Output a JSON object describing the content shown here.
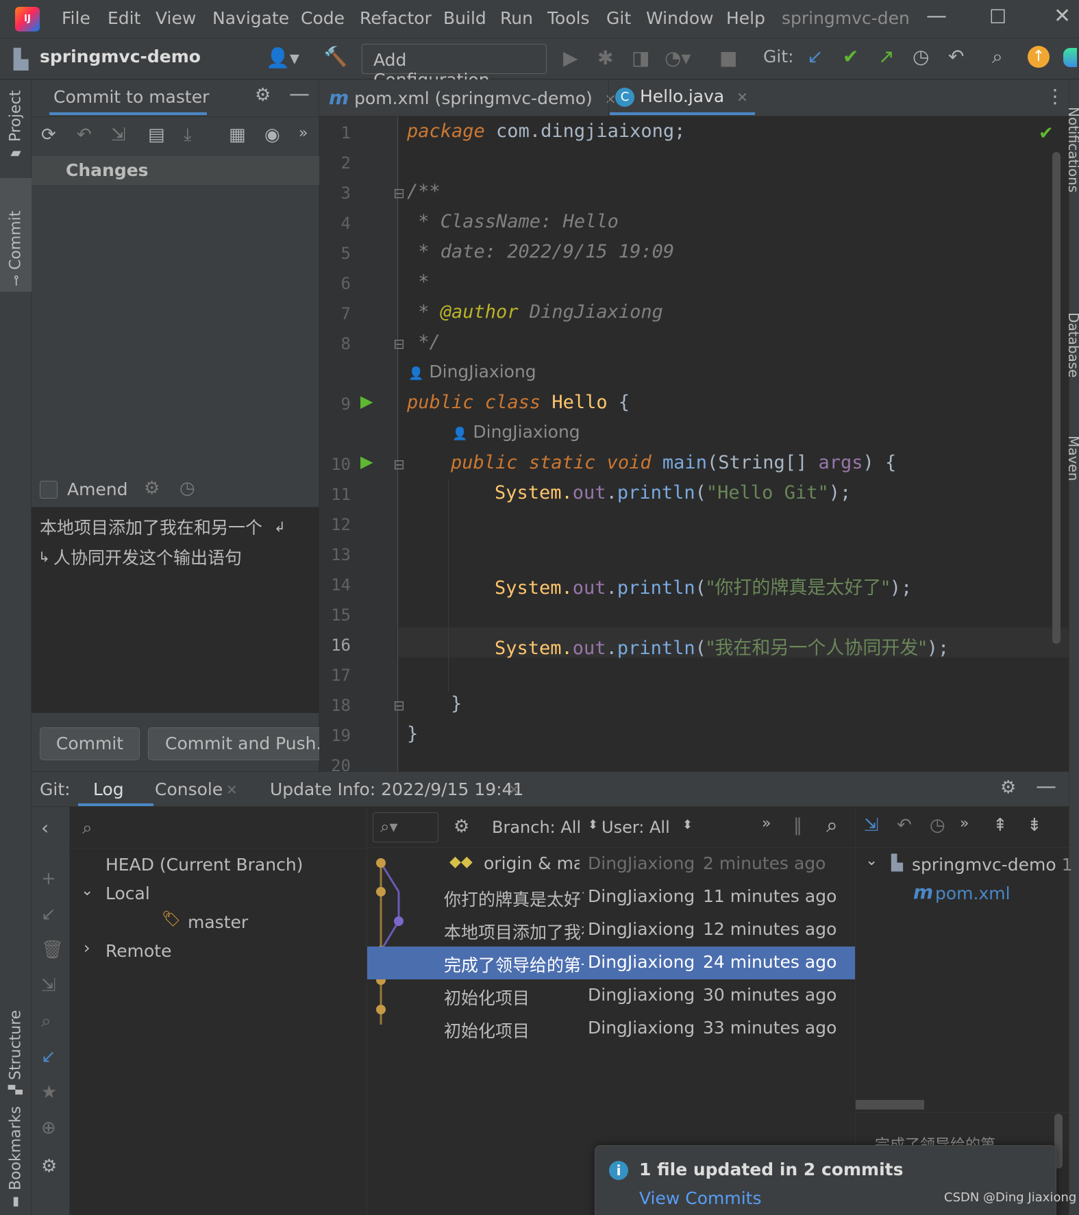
{
  "menu": {
    "items": [
      "File",
      "Edit",
      "View",
      "Navigate",
      "Code",
      "Refactor",
      "Build",
      "Run",
      "Tools",
      "Git",
      "Window",
      "Help"
    ],
    "project_title": "springmvc-den"
  },
  "toolbar": {
    "project_name": "springmvc-demo",
    "add_configuration": "Add Configuration...",
    "git_label": "Git:"
  },
  "left_tabs": {
    "project": "Project",
    "commit": "Commit",
    "structure": "Structure",
    "bookmarks": "Bookmarks"
  },
  "right_tabs": {
    "notifications": "Notifications",
    "database": "Database",
    "maven": "Maven"
  },
  "commit_panel": {
    "tab_label": "Commit to master",
    "changes_header": "Changes",
    "amend_label": "Amend",
    "message_line1": "本地项目添加了我在和另一个",
    "message_line2": "人协同开发这个输出语句",
    "commit_button": "Commit",
    "commit_push_button": "Commit and Push..."
  },
  "editor": {
    "tabs": [
      {
        "label": "pom.xml (springmvc-demo)",
        "active": false
      },
      {
        "label": "Hello.java",
        "active": true
      }
    ],
    "author_hint": "DingJiaxiong",
    "line_numbers": [
      "1",
      "2",
      "3",
      "4",
      "5",
      "6",
      "7",
      "8",
      "9",
      "10",
      "11",
      "12",
      "13",
      "14",
      "15",
      "16",
      "17",
      "18",
      "19",
      "20"
    ],
    "code": {
      "l1_kw": "package",
      "l1_rest": " com.dingjiaixong;",
      "l3": "/**",
      "l4": " * ClassName: Hello",
      "l5": " * date: 2022/9/15 19:09",
      "l6": " *",
      "l7_star": " * ",
      "l7_tag": "@author",
      "l7_rest": " DingJiaxiong",
      "l8": " */",
      "l9_kw1": "public",
      "l9_kw2": "class",
      "l9_name": "Hello",
      "l9_brace": " {",
      "l10_kw1": "public",
      "l10_kw2": "static",
      "l10_kw3": "void",
      "l10_fn": "main",
      "l10_args": "(String[] ",
      "l10_param": "args",
      "l10_end": ") {",
      "sys": "System.",
      "out": "out",
      "dot": ".",
      "println": "println",
      "l11_str": "\"Hello Git\"",
      "l14_str": "\"你打的牌真是太好了\"",
      "l16_str": "\"我在和另一个人协同开发\"",
      "open": "(",
      "close": ");",
      "l18": "}",
      "l19": "}"
    }
  },
  "bottom_bar": {
    "git_label": "Git:",
    "tabs": [
      "Log",
      "Console",
      "Update Info: 2022/9/15 19:41"
    ]
  },
  "git_log": {
    "branches": {
      "head": "HEAD (Current Branch)",
      "local": "Local",
      "master": "master",
      "remote": "Remote"
    },
    "filters": {
      "branch": "Branch: All",
      "user": "User: All"
    },
    "commits": [
      {
        "message": "origin & mast",
        "author": "DingJiaxiong",
        "time": "2 minutes ago",
        "selected": false
      },
      {
        "message": "你打的牌真是太好了",
        "author": "DingJiaxiong",
        "time": "11 minutes ago",
        "selected": false
      },
      {
        "message": "本地项目添加了我在",
        "author": "DingJiaxiong",
        "time": "12 minutes ago",
        "selected": false
      },
      {
        "message": "完成了领导给的第一",
        "author": "DingJiaxiong",
        "time": "24 minutes ago",
        "selected": true
      },
      {
        "message": "初始化项目",
        "author": "DingJiaxiong",
        "time": "30 minutes ago",
        "selected": false
      },
      {
        "message": "初始化项目",
        "author": "DingJiaxiong",
        "time": "33 minutes ago",
        "selected": false
      }
    ],
    "changed_tree": {
      "root": "springmvc-demo",
      "root_count": "1",
      "file": "pom.xml"
    },
    "detail_peek": "完成了领导给的第"
  },
  "notification": {
    "title": "1 file updated in 2 commits",
    "link": "View Commits"
  },
  "watermark": "CSDN @Ding Jiaxiong",
  "colors": {
    "selection": "#4b6eaf",
    "keyword": "#cc7832",
    "string": "#6a8759",
    "accent": "#4a88c7"
  }
}
